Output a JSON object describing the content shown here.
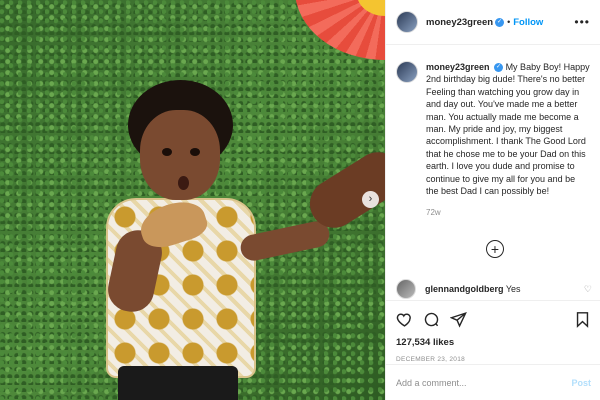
{
  "header": {
    "username": "money23green",
    "separator": "•",
    "follow_label": "Follow",
    "more_label": "•••"
  },
  "caption": {
    "username": "money23green",
    "text": "My Baby Boy! Happy 2nd birthday big dude! There's no better Feeling than watching you grow day in and day out. You've made me a better man. You actually made me become a man. My pride and joy, my biggest accomplishment. I thank The Good Lord that he chose me to be your Dad on this earth. I love you dude and promise to continue to give my all for you and be the best Dad I can possibly be!",
    "age": "72w"
  },
  "load_more_symbol": "+",
  "comment": {
    "username": "glennandgoldberg",
    "text": "Yes",
    "heart_symbol": "♡"
  },
  "actions": {
    "likes": "127,534 likes",
    "date": "DECEMBER 23, 2018"
  },
  "add_comment": {
    "placeholder": "Add a comment...",
    "post_label": "Post"
  },
  "photo": {
    "next_symbol": "›"
  },
  "colors": {
    "link_blue": "#0095f6",
    "verified_blue": "#3897f0",
    "muted_gray": "#8e8e8e",
    "post_disabled": "#b2dffc"
  }
}
